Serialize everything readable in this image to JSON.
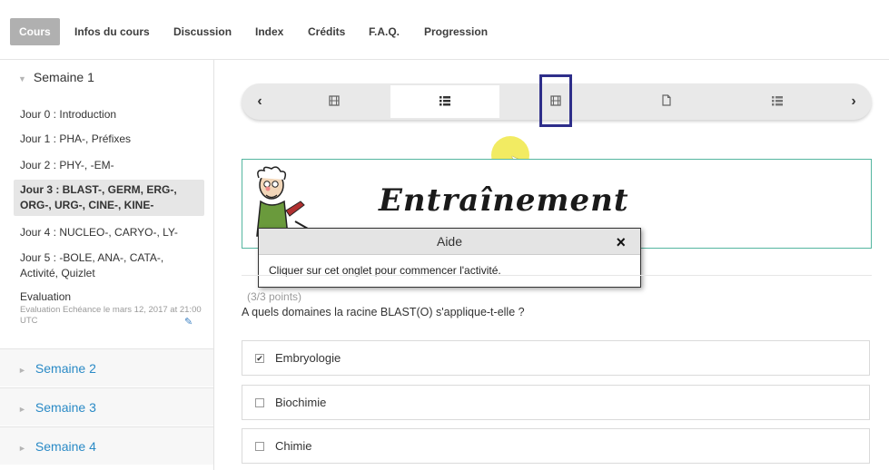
{
  "topnav": {
    "tabs": [
      "Cours",
      "Infos du cours",
      "Discussion",
      "Index",
      "Crédits",
      "F.A.Q.",
      "Progression"
    ]
  },
  "sidebar": {
    "open_week": "Semaine 1",
    "days": [
      "Jour 0 : Introduction",
      "Jour 1 : PHA-, Préfixes",
      "Jour 2 : PHY-, -EM-",
      "Jour 3 : BLAST-, GERM, ERG-, ORG-, URG-, CINE-, KINE-",
      "Jour 4 : NUCLEO-, CARYO-, LY-",
      "Jour 5 : -BOLE, ANA-, CATA-, Activité, Quizlet"
    ],
    "evaluation": {
      "title": "Evaluation",
      "subtitle": "Evaluation Echéance le mars 12, 2017 at 21:00 UTC"
    },
    "closed_weeks": [
      "Semaine 2",
      "Semaine 3",
      "Semaine 4"
    ]
  },
  "seqnav": {
    "prev": "‹",
    "next": "›",
    "icons": [
      "video-icon",
      "list-icon",
      "video-icon",
      "document-icon",
      "list-icon"
    ]
  },
  "banner": {
    "title": "Entraînement"
  },
  "tooltip": {
    "title": "Aide",
    "close": "×",
    "body": "Cliquer sur cet onglet pour commencer l'activité."
  },
  "problem": {
    "points": "(3/3 points)",
    "question": "A quels domaines la racine BLAST(O) s'applique-t-elle ?",
    "choices": [
      {
        "label": "Embryologie",
        "checked": true
      },
      {
        "label": "Biochimie",
        "checked": false
      },
      {
        "label": "Chimie",
        "checked": false
      }
    ]
  }
}
